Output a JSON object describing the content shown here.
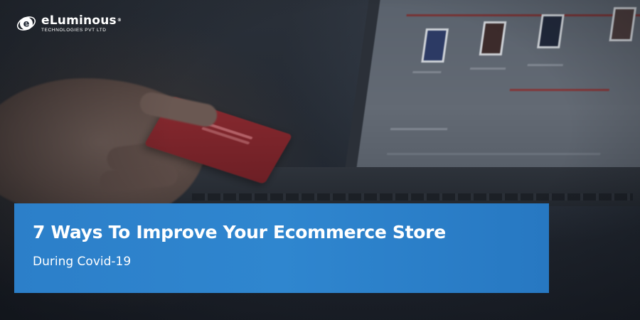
{
  "logo": {
    "name": "eLuminous",
    "registered": "®",
    "tagline": "TECHNOLOGIES PVT LTD"
  },
  "banner": {
    "title": "7 Ways To Improve Your Ecommerce Store",
    "subtitle": "During Covid-19"
  },
  "colors": {
    "banner_blue": "#2c7fc9",
    "text": "#ffffff",
    "card_red": "#8a2a30"
  }
}
